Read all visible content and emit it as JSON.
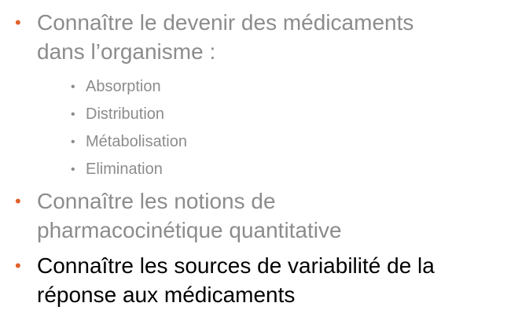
{
  "colors": {
    "bullet": "#e0602a",
    "dim_text": "#8c8c8c",
    "active_text": "#000000"
  },
  "bullets": [
    {
      "lines": [
        "Connaître le devenir des médicaments",
        "dans l’organisme :"
      ],
      "state": "dim",
      "sub_items": [
        "Absorption",
        "Distribution",
        "Métabolisation",
        "Elimination"
      ]
    },
    {
      "lines": [
        "Connaître les notions de",
        "pharmacocinétique quantitative"
      ],
      "state": "dim"
    },
    {
      "lines": [
        "Connaître les sources de variabilité de la",
        "réponse aux médicaments"
      ],
      "state": "active"
    }
  ]
}
